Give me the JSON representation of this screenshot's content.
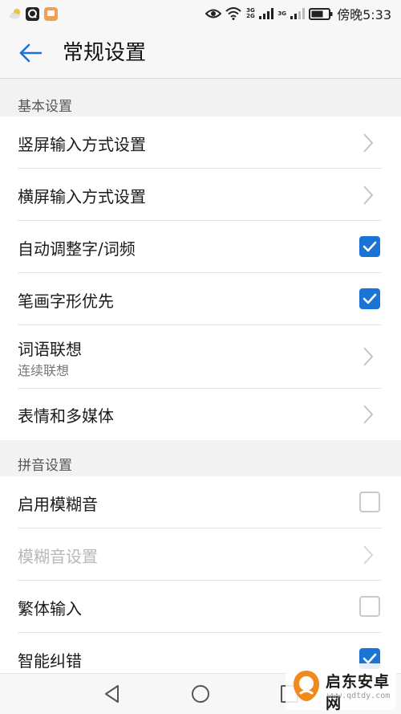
{
  "status_bar": {
    "time": "傍晚5:33",
    "network_1": "3G 2G",
    "network_2": "3G",
    "icons": [
      "weather-icon",
      "q-app-icon",
      "message-app-icon",
      "eye-icon",
      "wifi-icon",
      "signal-icon",
      "battery-icon"
    ]
  },
  "app_bar": {
    "title": "常规设置",
    "accent": "#1a74d6"
  },
  "sections": {
    "basic": {
      "header": "基本设置",
      "items": [
        {
          "label": "竖屏输入方式设置",
          "control": "chevron"
        },
        {
          "label": "横屏输入方式设置",
          "control": "chevron"
        },
        {
          "label": "自动调整字/词频",
          "control": "checkbox",
          "checked": true
        },
        {
          "label": "笔画字形优先",
          "control": "checkbox",
          "checked": true
        },
        {
          "label": "词语联想",
          "sub": "连续联想",
          "control": "chevron"
        },
        {
          "label": "表情和多媒体",
          "control": "chevron"
        }
      ]
    },
    "pinyin": {
      "header": "拼音设置",
      "items": [
        {
          "label": "启用模糊音",
          "control": "checkbox",
          "checked": false
        },
        {
          "label": "模糊音设置",
          "control": "chevron",
          "disabled": true
        },
        {
          "label": "繁体输入",
          "control": "checkbox",
          "checked": false
        },
        {
          "label": "智能纠错",
          "control": "checkbox",
          "checked": true
        }
      ]
    }
  },
  "watermark": {
    "name": "启东安卓网",
    "url": "www.qdtdy.com"
  },
  "colors": {
    "checkbox_on": "#1a74d6",
    "checkbox_off_border": "#c9c9c9",
    "section_bg": "#f2f2f2"
  }
}
